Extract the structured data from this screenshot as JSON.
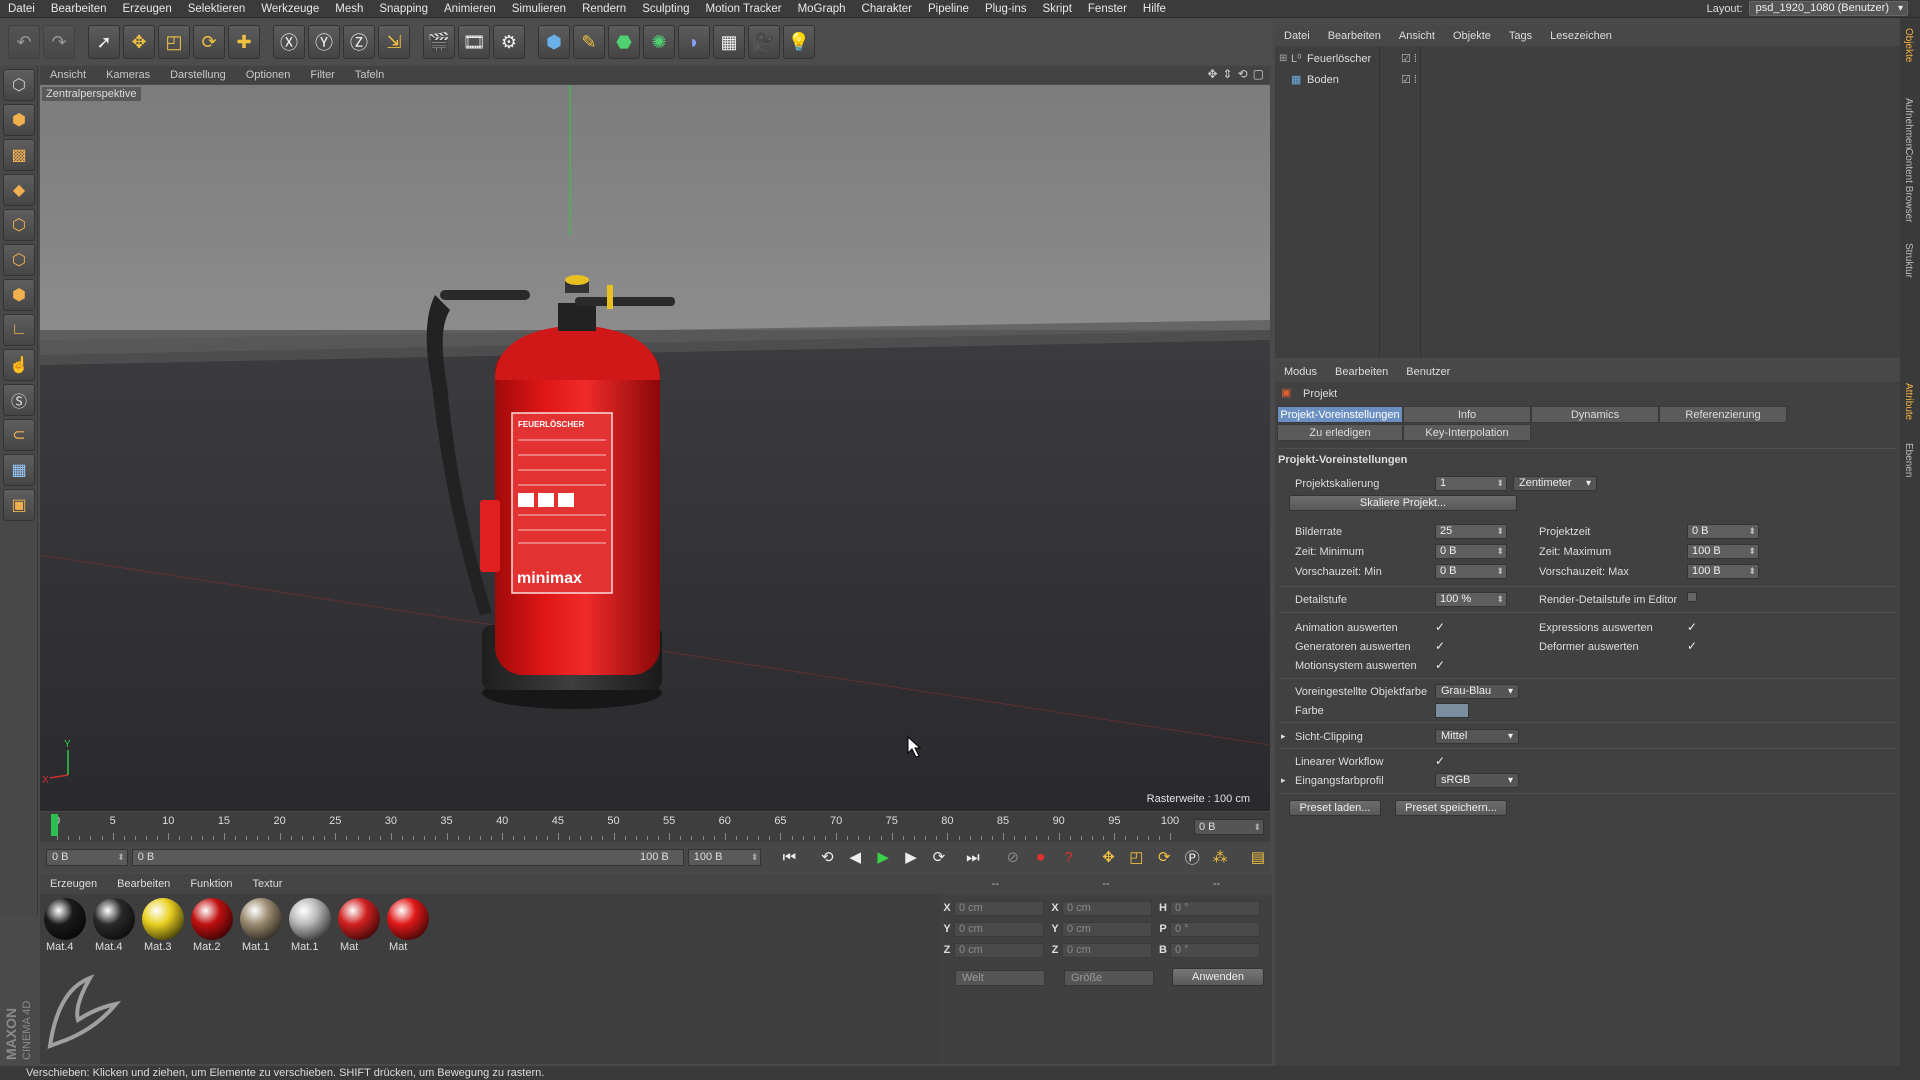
{
  "menu": [
    "Datei",
    "Bearbeiten",
    "Erzeugen",
    "Selektieren",
    "Werkzeuge",
    "Mesh",
    "Snapping",
    "Animieren",
    "Simulieren",
    "Rendern",
    "Sculpting",
    "Motion Tracker",
    "MoGraph",
    "Charakter",
    "Pipeline",
    "Plug-ins",
    "Skript",
    "Fenster",
    "Hilfe"
  ],
  "layout": {
    "label": "Layout:",
    "value": "psd_1920_1080 (Benutzer)"
  },
  "viewport": {
    "menu": [
      "Ansicht",
      "Kameras",
      "Darstellung",
      "Optionen",
      "Filter",
      "Tafeln"
    ],
    "camera_label": "Zentralperspektive",
    "raster": "Rasterweite : 100 cm",
    "axis_x": "X",
    "axis_y": "Y",
    "extinguisher": {
      "brand": "minimax",
      "label_title": "FEUERLÖSCHER"
    }
  },
  "timeline": {
    "ticks": [
      "0",
      "5",
      "10",
      "15",
      "20",
      "25",
      "30",
      "35",
      "40",
      "45",
      "50",
      "55",
      "60",
      "65",
      "70",
      "75",
      "80",
      "85",
      "90",
      "95",
      "100"
    ],
    "current": "0 B"
  },
  "transport": {
    "start": "0 B",
    "range_start": "0 B",
    "range_end": "100 B",
    "end": "100 B"
  },
  "materials": {
    "menu": [
      "Erzeugen",
      "Bearbeiten",
      "Funktion",
      "Textur"
    ],
    "items": [
      {
        "name": "Mat.4",
        "color": "#1a1a1a"
      },
      {
        "name": "Mat.4",
        "color": "#2a2a2a"
      },
      {
        "name": "Mat.3",
        "color": "#e8d020"
      },
      {
        "name": "Mat.2",
        "color": "#c01010"
      },
      {
        "name": "Mat.1",
        "color": "#9a8a70"
      },
      {
        "name": "Mat.1",
        "color": "#b8b8b8"
      },
      {
        "name": "Mat",
        "color": "#d02020"
      },
      {
        "name": "Mat",
        "color": "#e01818"
      }
    ]
  },
  "coords": {
    "header": [
      "--",
      "--",
      "--"
    ],
    "rows": [
      {
        "a": "X",
        "av": "0 cm",
        "b": "X",
        "bv": "0 cm",
        "c": "H",
        "cv": "0 °"
      },
      {
        "a": "Y",
        "av": "0 cm",
        "b": "Y",
        "bv": "0 cm",
        "c": "P",
        "cv": "0 °"
      },
      {
        "a": "Z",
        "av": "0 cm",
        "b": "Z",
        "bv": "0 cm",
        "c": "B",
        "cv": "0 °"
      }
    ],
    "world": "Welt",
    "size": "Größe",
    "apply": "Anwenden"
  },
  "status": "Verschieben: Klicken und ziehen, um Elemente zu verschieben. SHIFT drücken, um Bewegung zu rastern.",
  "objects": {
    "menu": [
      "Datei",
      "Bearbeiten",
      "Ansicht",
      "Objekte",
      "Tags",
      "Lesezeichen"
    ],
    "items": [
      "Feuerlöscher",
      "Boden"
    ]
  },
  "attributes": {
    "menu": [
      "Modus",
      "Bearbeiten",
      "Benutzer"
    ],
    "title": "Projekt",
    "tabs": [
      "Projekt-Voreinstellungen",
      "Info",
      "Dynamics",
      "Referenzierung",
      "Zu erledigen",
      "Key-Interpolation"
    ],
    "section": "Projekt-Voreinstellungen",
    "scale_label": "Projektskalierung",
    "scale_value": "1",
    "scale_unit": "Zentimeter",
    "scale_btn": "Skaliere Projekt...",
    "fps_label": "Bilderrate",
    "fps_value": "25",
    "ptime_label": "Projektzeit",
    "ptime_value": "0 B",
    "tmin_label": "Zeit: Minimum",
    "tmin_value": "0 B",
    "tmax_label": "Zeit: Maximum",
    "tmax_value": "100 B",
    "pmin_label": "Vorschauzeit: Min",
    "pmin_value": "0 B",
    "pmax_label": "Vorschauzeit: Max",
    "pmax_value": "100 B",
    "lod_label": "Detailstufe",
    "lod_value": "100 %",
    "rlod_label": "Render-Detailstufe im Editor",
    "anim_label": "Animation auswerten",
    "expr_label": "Expressions auswerten",
    "gen_label": "Generatoren auswerten",
    "def_label": "Deformer auswerten",
    "motion_label": "Motionsystem auswerten",
    "objcolor_label": "Voreingestellte Objektfarbe",
    "objcolor_value": "Grau-Blau",
    "color_label": "Farbe",
    "clip_label": "Sicht-Clipping",
    "clip_value": "Mittel",
    "linear_label": "Linearer Workflow",
    "profile_label": "Eingangsfarbprofil",
    "profile_value": "sRGB",
    "preset_load": "Preset laden...",
    "preset_save": "Preset speichern..."
  },
  "vstrip": [
    "Objekte",
    "Aufnehmen",
    "Content Browser",
    "Struktur",
    "Attribute",
    "Ebenen"
  ],
  "logo": {
    "maxon": "MAXON",
    "cinema": "CINEMA 4D"
  }
}
